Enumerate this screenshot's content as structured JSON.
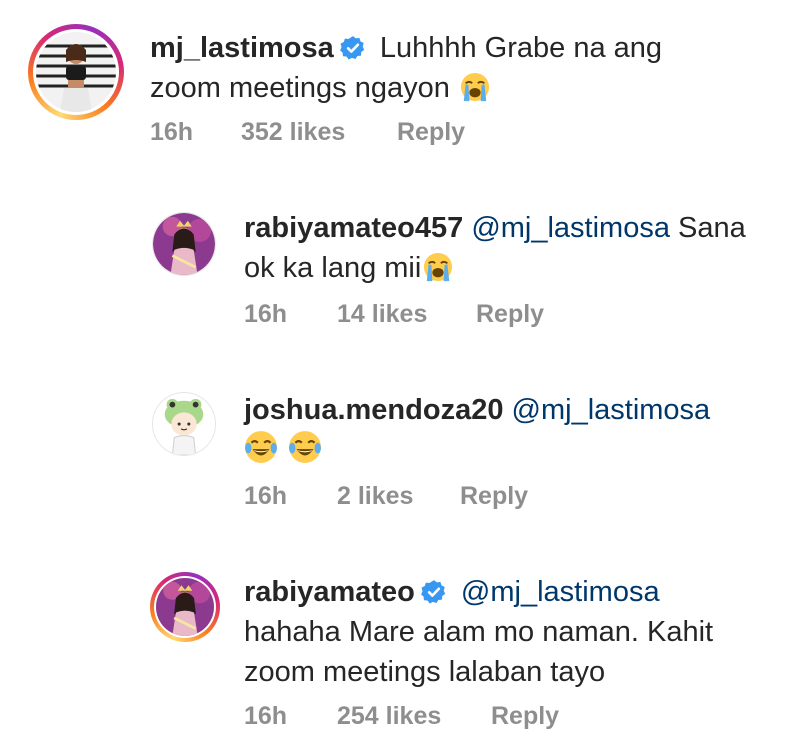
{
  "comments": [
    {
      "username": "mj_lastimosa",
      "verified": true,
      "mention": "",
      "text_line1": "Luhhhh Grabe na ang",
      "text_line2": "zoom meetings ngayon",
      "emoji": "loudly-crying-face",
      "time": "16h",
      "likes": "352 likes",
      "reply": "Reply"
    },
    {
      "username": "rabiyamateo457",
      "verified": false,
      "mention": "@mj_lastimosa",
      "text_line1": "Sana",
      "text_line2": "ok ka lang mii",
      "emoji": "loudly-crying-face",
      "time": "16h",
      "likes": "14 likes",
      "reply": "Reply"
    },
    {
      "username": "joshua.mendoza20",
      "verified": false,
      "mention": "@mj_lastimosa",
      "text_line1": "",
      "text_line2": "",
      "emoji": "face-with-tears-of-joy x2",
      "time": "16h",
      "likes": "2 likes",
      "reply": "Reply"
    },
    {
      "username": "rabiyamateo",
      "verified": true,
      "mention": "@mj_lastimosa",
      "text_line1": "hahaha Mare alam mo naman. Kahit",
      "text_line2": "zoom meetings lalaban tayo",
      "emoji": "",
      "time": "16h",
      "likes": "254 likes",
      "reply": "Reply"
    }
  ],
  "colors": {
    "text": "#262626",
    "meta": "#8e8e8e",
    "mention": "#00376b",
    "verified": "#3897f0"
  }
}
